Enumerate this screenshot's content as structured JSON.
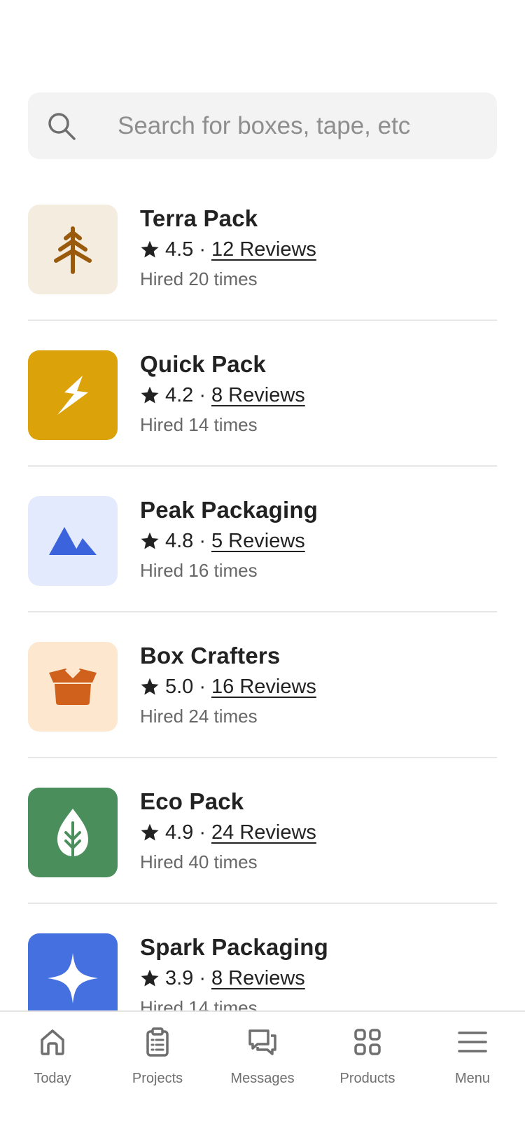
{
  "search": {
    "placeholder": "Search for boxes, tape, etc",
    "icon": "search-icon"
  },
  "vendors": [
    {
      "name": "Terra Pack",
      "rating": "4.5",
      "reviews": "12 Reviews",
      "hired": "Hired 20 times",
      "icon": "pine-tree-icon",
      "bg": "#f5ece0",
      "fg": "#9a5a0c"
    },
    {
      "name": "Quick Pack",
      "rating": "4.2",
      "reviews": "8 Reviews",
      "hired": "Hired 14 times",
      "icon": "lightning-icon",
      "bg": "#dca20a",
      "fg": "#ffffff"
    },
    {
      "name": "Peak Packaging",
      "rating": "4.8",
      "reviews": "5 Reviews",
      "hired": "Hired 16 times",
      "icon": "mountains-icon",
      "bg": "#e4eafd",
      "fg": "#3b63db"
    },
    {
      "name": "Box Crafters",
      "rating": "5.0",
      "reviews": "16 Reviews",
      "hired": "Hired 24 times",
      "icon": "open-box-icon",
      "bg": "#fde8cf",
      "fg": "#cf611d"
    },
    {
      "name": "Eco Pack",
      "rating": "4.9",
      "reviews": "24 Reviews",
      "hired": "Hired 40 times",
      "icon": "leaf-icon",
      "bg": "#4a8e5c",
      "fg": "#ffffff"
    },
    {
      "name": "Spark Packaging",
      "rating": "3.9",
      "reviews": "8 Reviews",
      "hired": "Hired 14 times",
      "icon": "sparkle-icon",
      "bg": "#4470e0",
      "fg": "#ffffff"
    }
  ],
  "tabs": [
    {
      "label": "Today",
      "icon": "home-icon"
    },
    {
      "label": "Projects",
      "icon": "clipboard-icon"
    },
    {
      "label": "Messages",
      "icon": "chat-icon"
    },
    {
      "label": "Products",
      "icon": "grid-icon"
    },
    {
      "label": "Menu",
      "icon": "hamburger-icon"
    }
  ],
  "colors": {
    "text": "#222222",
    "muted": "#676767",
    "search_bg": "#f3f3f3",
    "divider": "#e6e6e6"
  }
}
